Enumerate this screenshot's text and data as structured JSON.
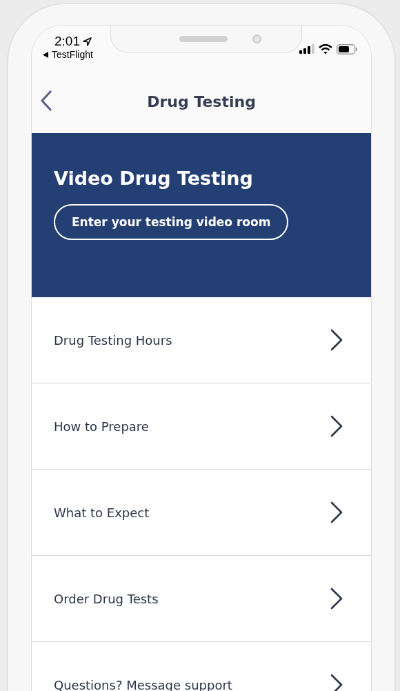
{
  "status_bar": {
    "time": "2:01",
    "back_label": "TestFlight"
  },
  "header": {
    "title": "Drug Testing"
  },
  "banner": {
    "title": "Video Drug Testing",
    "button": "Enter your testing video room"
  },
  "menu": [
    {
      "label": "Drug Testing Hours"
    },
    {
      "label": "How to Prepare"
    },
    {
      "label": "What to Expect"
    },
    {
      "label": "Order Drug Tests"
    },
    {
      "label": "Questions? Message support"
    }
  ]
}
